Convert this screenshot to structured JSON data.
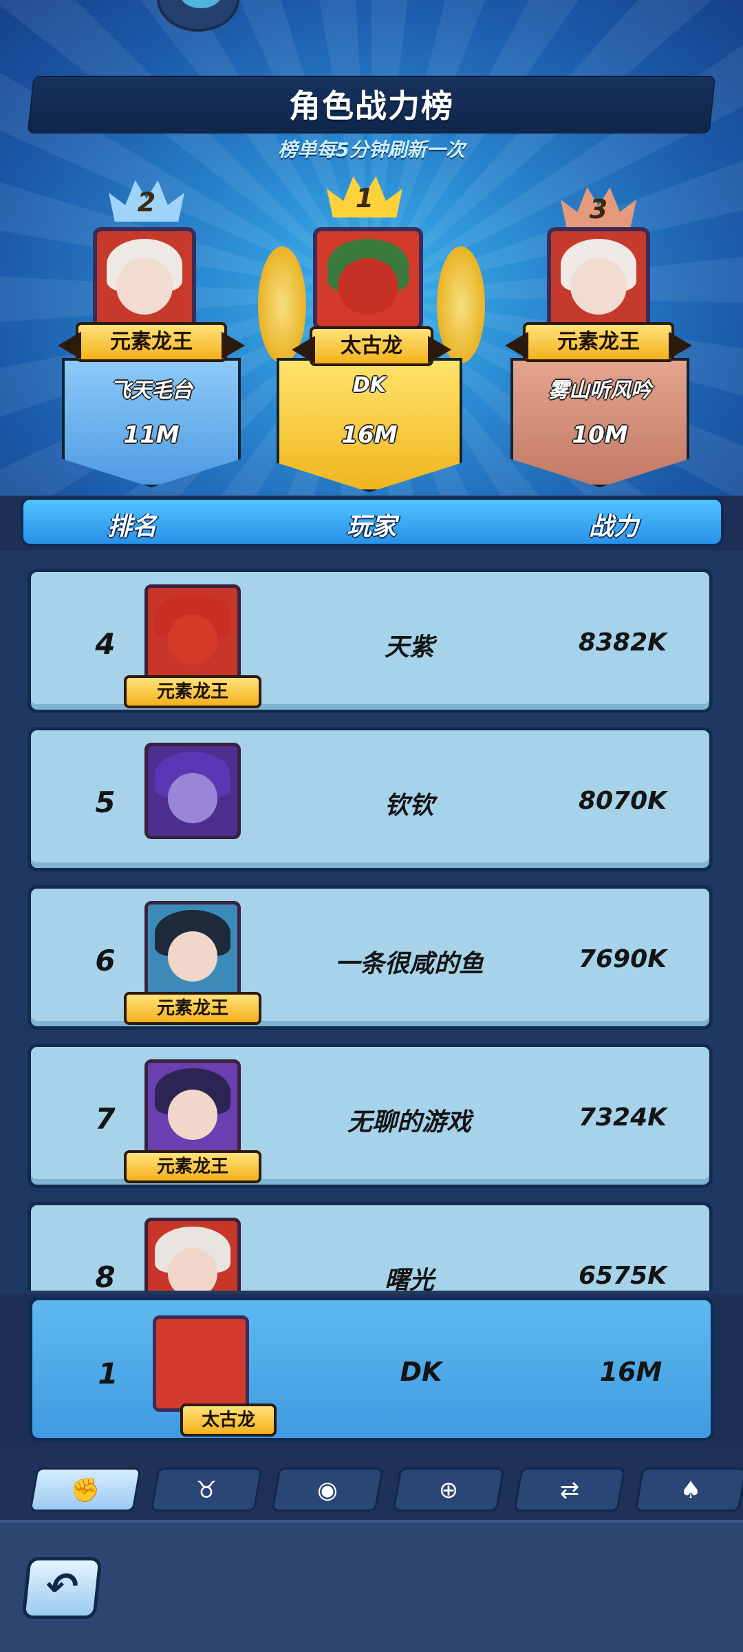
{
  "header": {
    "title": "角色战力榜",
    "subtitle": "榜单每5分钟刷新一次"
  },
  "podium": [
    {
      "rank": "2",
      "badge": "元素龙王",
      "player": "飞天毛台",
      "power": "11M",
      "plate_color": "#6fb3ef",
      "crown_color": "#9fd3f7"
    },
    {
      "rank": "1",
      "badge": "太古龙",
      "player": "DK",
      "power": "16M",
      "plate_color": "#f4c532",
      "crown_color": "#ffd23a"
    },
    {
      "rank": "3",
      "badge": "元素龙王",
      "player": "雾山听风吟",
      "power": "10M",
      "plate_color": "#d5907a",
      "crown_color": "#e59a7e"
    }
  ],
  "columns": {
    "rank": "排名",
    "player": "玩家",
    "power": "战力"
  },
  "rows": [
    {
      "rank": "4",
      "player": "天紫",
      "power": "8382K",
      "badge": "元素龙王",
      "hair": "#c62f22"
    },
    {
      "rank": "5",
      "player": "钦钦",
      "power": "8070K",
      "badge": "",
      "hair": "#5a37b5"
    },
    {
      "rank": "6",
      "player": "一条很咸的鱼",
      "power": "7690K",
      "badge": "元素龙王",
      "hair": "#1e2a3c"
    },
    {
      "rank": "7",
      "player": "无聊的游戏",
      "power": "7324K",
      "badge": "元素龙王",
      "hair": "#2c2554"
    },
    {
      "rank": "8",
      "player": "曙光",
      "power": "6575K",
      "badge": "",
      "hair": "#e8e4e0"
    }
  ],
  "self": {
    "rank": "1",
    "player": "DK",
    "power": "16M",
    "badge": "太古龙"
  },
  "tabs": [
    {
      "icon": "fist-icon",
      "glyph": "✊"
    },
    {
      "icon": "bull-horns-icon",
      "glyph": "♉"
    },
    {
      "icon": "spiral-card-icon",
      "glyph": "◉"
    },
    {
      "icon": "shield-card-icon",
      "glyph": "⊕"
    },
    {
      "icon": "swap-card-icon",
      "glyph": "⇄"
    },
    {
      "icon": "spade-card-icon",
      "glyph": "♠"
    }
  ],
  "back": {
    "icon": "back-arrow-icon",
    "glyph": "↶"
  }
}
